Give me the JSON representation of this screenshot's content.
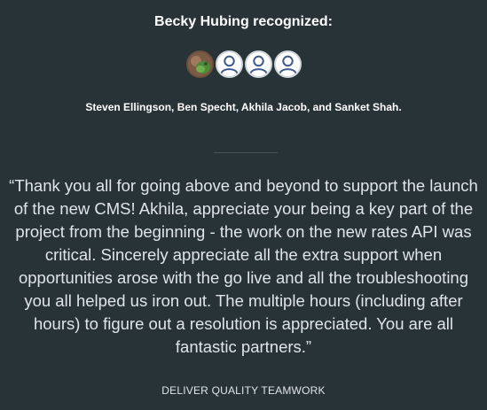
{
  "recognition": {
    "heading": "Becky Hubing recognized:",
    "recipients_text": "Steven Ellingson, Ben Specht, Akhila Jacob, and Sanket Shah.",
    "message": "“Thank you all for going above and beyond to support the launch of the new CMS! Akhila, appreciate your being a key part of the project from the beginning - the work on the new rates API was critical. Sincerely appreciate all the extra support when opportunities arose with the go live and all the troubleshooting you all helped us iron out. The multiple hours (including after hours) to figure out a resolution is appreciated. You are all fantastic partners.”",
    "value_tag": "DELIVER QUALITY TEAMWORK"
  },
  "avatars": [
    {
      "type": "photo",
      "icon": "user-photo-avatar"
    },
    {
      "type": "placeholder",
      "icon": "default-user-icon"
    },
    {
      "type": "placeholder",
      "icon": "default-user-icon"
    },
    {
      "type": "placeholder",
      "icon": "default-user-icon"
    }
  ],
  "colors": {
    "background": "#283338",
    "text": "#ffffff",
    "quote_text": "#dfe5e8",
    "placeholder_icon": "#3d5a8a"
  }
}
